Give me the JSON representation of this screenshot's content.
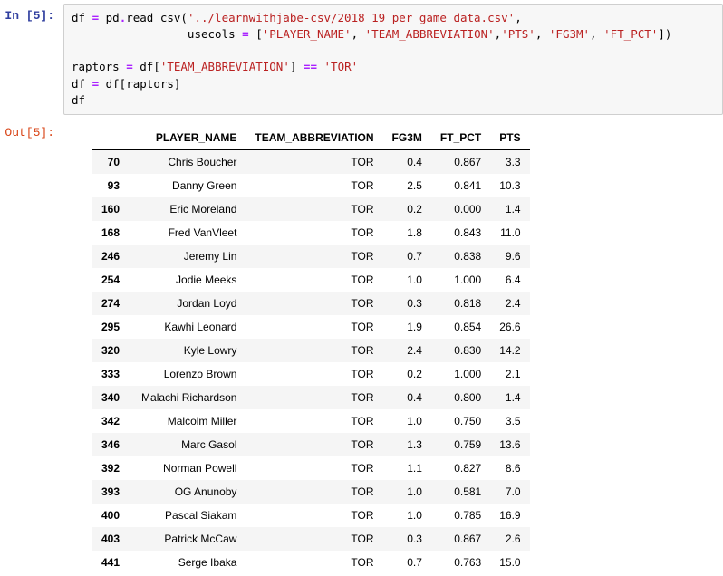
{
  "in_prompt": "In [5]:",
  "out_prompt": "Out[5]:",
  "code": {
    "l1a": "df ",
    "l1op1": "=",
    "l1b": " pd",
    "l1dot": ".",
    "l1c": "read_csv(",
    "l1str": "'../learnwithjabe-csv/2018_19_per_game_data.csv'",
    "l1end": ",",
    "l2pad": "                 usecols ",
    "l2op": "=",
    "l2a": " [",
    "l2s1": "'PLAYER_NAME'",
    "l2c1": ", ",
    "l2s2": "'TEAM_ABBREVIATION'",
    "l2c2": ",",
    "l2s3": "'PTS'",
    "l2c3": ", ",
    "l2s4": "'FG3M'",
    "l2c4": ", ",
    "l2s5": "'FT_PCT'",
    "l2end": "])",
    "l4a": "raptors ",
    "l4op1": "=",
    "l4b": " df[",
    "l4s1": "'TEAM_ABBREVIATION'",
    "l4c": "] ",
    "l4op2": "==",
    "l4d": " ",
    "l4s2": "'TOR'",
    "l5a": "df ",
    "l5op": "=",
    "l5b": " df[raptors]",
    "l6": "df"
  },
  "columns": [
    "PLAYER_NAME",
    "TEAM_ABBREVIATION",
    "FG3M",
    "FT_PCT",
    "PTS"
  ],
  "rows": [
    {
      "idx": "70",
      "player": "Chris Boucher",
      "team": "TOR",
      "fg3m": "0.4",
      "ft": "0.867",
      "pts": "3.3"
    },
    {
      "idx": "93",
      "player": "Danny Green",
      "team": "TOR",
      "fg3m": "2.5",
      "ft": "0.841",
      "pts": "10.3"
    },
    {
      "idx": "160",
      "player": "Eric Moreland",
      "team": "TOR",
      "fg3m": "0.2",
      "ft": "0.000",
      "pts": "1.4"
    },
    {
      "idx": "168",
      "player": "Fred VanVleet",
      "team": "TOR",
      "fg3m": "1.8",
      "ft": "0.843",
      "pts": "11.0"
    },
    {
      "idx": "246",
      "player": "Jeremy Lin",
      "team": "TOR",
      "fg3m": "0.7",
      "ft": "0.838",
      "pts": "9.6"
    },
    {
      "idx": "254",
      "player": "Jodie Meeks",
      "team": "TOR",
      "fg3m": "1.0",
      "ft": "1.000",
      "pts": "6.4"
    },
    {
      "idx": "274",
      "player": "Jordan Loyd",
      "team": "TOR",
      "fg3m": "0.3",
      "ft": "0.818",
      "pts": "2.4"
    },
    {
      "idx": "295",
      "player": "Kawhi Leonard",
      "team": "TOR",
      "fg3m": "1.9",
      "ft": "0.854",
      "pts": "26.6"
    },
    {
      "idx": "320",
      "player": "Kyle Lowry",
      "team": "TOR",
      "fg3m": "2.4",
      "ft": "0.830",
      "pts": "14.2"
    },
    {
      "idx": "333",
      "player": "Lorenzo Brown",
      "team": "TOR",
      "fg3m": "0.2",
      "ft": "1.000",
      "pts": "2.1"
    },
    {
      "idx": "340",
      "player": "Malachi Richardson",
      "team": "TOR",
      "fg3m": "0.4",
      "ft": "0.800",
      "pts": "1.4"
    },
    {
      "idx": "342",
      "player": "Malcolm Miller",
      "team": "TOR",
      "fg3m": "1.0",
      "ft": "0.750",
      "pts": "3.5"
    },
    {
      "idx": "346",
      "player": "Marc Gasol",
      "team": "TOR",
      "fg3m": "1.3",
      "ft": "0.759",
      "pts": "13.6"
    },
    {
      "idx": "392",
      "player": "Norman Powell",
      "team": "TOR",
      "fg3m": "1.1",
      "ft": "0.827",
      "pts": "8.6"
    },
    {
      "idx": "393",
      "player": "OG Anunoby",
      "team": "TOR",
      "fg3m": "1.0",
      "ft": "0.581",
      "pts": "7.0"
    },
    {
      "idx": "400",
      "player": "Pascal Siakam",
      "team": "TOR",
      "fg3m": "1.0",
      "ft": "0.785",
      "pts": "16.9"
    },
    {
      "idx": "403",
      "player": "Patrick McCaw",
      "team": "TOR",
      "fg3m": "0.3",
      "ft": "0.867",
      "pts": "2.6"
    },
    {
      "idx": "441",
      "player": "Serge Ibaka",
      "team": "TOR",
      "fg3m": "0.7",
      "ft": "0.763",
      "pts": "15.0"
    }
  ]
}
